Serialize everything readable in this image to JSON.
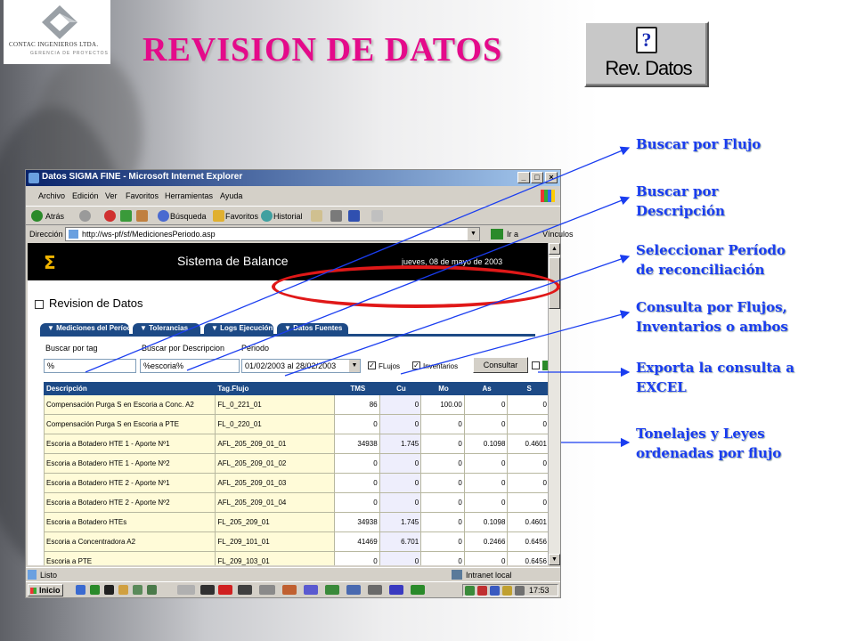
{
  "logo": {
    "company": "CONTAC INGENIEROS LTDA.",
    "tagline": "GERENCIA DE PROYECTOS"
  },
  "title": "REVISION DE DATOS",
  "rev_button": {
    "label": "Rev. Datos",
    "icon": "question-document-icon"
  },
  "annotations": [
    {
      "id": "flujo",
      "text": "Buscar por Flujo"
    },
    {
      "id": "descripcion",
      "text": "Buscar por Descripción"
    },
    {
      "id": "periodo",
      "text": "Seleccionar Período de reconciliación"
    },
    {
      "id": "consulta",
      "text": "Consulta por Flujos, Inventarios o ambos"
    },
    {
      "id": "exporta",
      "text": "Exporta la consulta a EXCEL"
    },
    {
      "id": "tonelajes",
      "text": "Tonelajes y Leyes ordenadas por flujo"
    }
  ],
  "colors": {
    "title": "#e40a8a",
    "annotation": "#1a3df0",
    "header_blue": "#1d4a86",
    "highlight_red": "#e01818"
  },
  "browser": {
    "window_title": "Datos SIGMA FINE - Microsoft Internet Explorer",
    "menu": [
      "Archivo",
      "Edición",
      "Ver",
      "Favoritos",
      "Herramientas",
      "Ayuda"
    ],
    "toolbar": {
      "back": "Atrás",
      "search": "Búsqueda",
      "favorites": "Favoritos",
      "history": "Historial"
    },
    "address_label": "Dirección",
    "address": "http://ws-pf/sf/MedicionesPeriodo.asp",
    "go": "Ir a",
    "links": "Vínculos",
    "status": "Listo",
    "zone": "Intranet local",
    "start": "Inicio",
    "clock": "17:53"
  },
  "app": {
    "system_name": "Sistema de Balance",
    "date": "jueves, 08 de mayo de 2003",
    "page_title": "Revision de Datos",
    "tabs": [
      "Mediciones del Período",
      "Tolerancias",
      "Logs Ejecución",
      "Datos Fuentes"
    ],
    "filters": {
      "tag_label": "Buscar por tag",
      "tag_value": "%",
      "desc_label": "Buscar por Descripcion",
      "desc_value": "%escoria%",
      "period_label": "Periodo",
      "period_value": "01/02/2003  al  28/02/2003",
      "flujos_label": "FLujos",
      "inventarios_label": "Inventarios",
      "consultar": "Consultar"
    },
    "table": {
      "columns": [
        "Descripción",
        "Tag.Flujo",
        "TMS",
        "Cu",
        "Mo",
        "As",
        "S"
      ],
      "rows": [
        [
          "Compensación Purga S en Escoria a Conc. A2",
          "FL_0_221_01",
          "86",
          "0",
          "100.00",
          "0",
          "0"
        ],
        [
          "Compensación Purga S en Escoria a PTE",
          "FL_0_220_01",
          "0",
          "0",
          "0",
          "0",
          "0"
        ],
        [
          "Escoria a Botadero HTE 1 - Aporte Nº1",
          "AFL_205_209_01_01",
          "34938",
          "1.745",
          "0",
          "0.1098",
          "0.4601"
        ],
        [
          "Escoria a Botadero HTE 1 - Aporte Nº2",
          "AFL_205_209_01_02",
          "0",
          "0",
          "0",
          "0",
          "0"
        ],
        [
          "Escoria a Botadero HTE 2 - Aporte Nº1",
          "AFL_205_209_01_03",
          "0",
          "0",
          "0",
          "0",
          "0"
        ],
        [
          "Escoria a Botadero HTE 2 - Aporte Nº2",
          "AFL_205_209_01_04",
          "0",
          "0",
          "0",
          "0",
          "0"
        ],
        [
          "Escoria a Botadero HTEs",
          "FL_205_209_01",
          "34938",
          "1.745",
          "0",
          "0.1098",
          "0.4601"
        ],
        [
          "Escoria a Concentradora A2",
          "FL_209_101_01",
          "41469",
          "6.701",
          "0",
          "0.2466",
          "0.6456"
        ],
        [
          "Escoria a PTE",
          "FL_209_103_01",
          "0",
          "0",
          "0",
          "0",
          "0.6456"
        ]
      ]
    }
  }
}
